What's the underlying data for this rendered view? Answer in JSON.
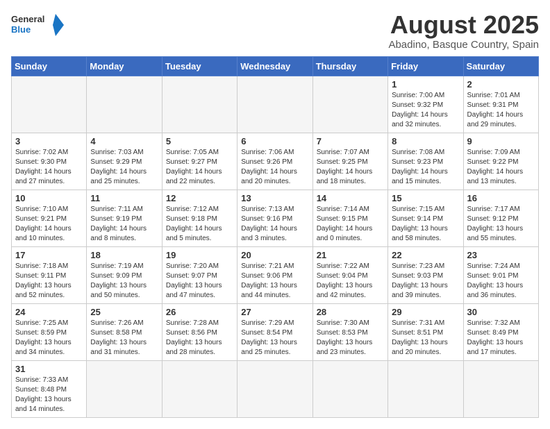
{
  "header": {
    "logo_general": "General",
    "logo_blue": "Blue",
    "title": "August 2025",
    "subtitle": "Abadino, Basque Country, Spain"
  },
  "weekdays": [
    "Sunday",
    "Monday",
    "Tuesday",
    "Wednesday",
    "Thursday",
    "Friday",
    "Saturday"
  ],
  "weeks": [
    [
      {
        "day": "",
        "info": ""
      },
      {
        "day": "",
        "info": ""
      },
      {
        "day": "",
        "info": ""
      },
      {
        "day": "",
        "info": ""
      },
      {
        "day": "",
        "info": ""
      },
      {
        "day": "1",
        "info": "Sunrise: 7:00 AM\nSunset: 9:32 PM\nDaylight: 14 hours and 32 minutes."
      },
      {
        "day": "2",
        "info": "Sunrise: 7:01 AM\nSunset: 9:31 PM\nDaylight: 14 hours and 29 minutes."
      }
    ],
    [
      {
        "day": "3",
        "info": "Sunrise: 7:02 AM\nSunset: 9:30 PM\nDaylight: 14 hours and 27 minutes."
      },
      {
        "day": "4",
        "info": "Sunrise: 7:03 AM\nSunset: 9:29 PM\nDaylight: 14 hours and 25 minutes."
      },
      {
        "day": "5",
        "info": "Sunrise: 7:05 AM\nSunset: 9:27 PM\nDaylight: 14 hours and 22 minutes."
      },
      {
        "day": "6",
        "info": "Sunrise: 7:06 AM\nSunset: 9:26 PM\nDaylight: 14 hours and 20 minutes."
      },
      {
        "day": "7",
        "info": "Sunrise: 7:07 AM\nSunset: 9:25 PM\nDaylight: 14 hours and 18 minutes."
      },
      {
        "day": "8",
        "info": "Sunrise: 7:08 AM\nSunset: 9:23 PM\nDaylight: 14 hours and 15 minutes."
      },
      {
        "day": "9",
        "info": "Sunrise: 7:09 AM\nSunset: 9:22 PM\nDaylight: 14 hours and 13 minutes."
      }
    ],
    [
      {
        "day": "10",
        "info": "Sunrise: 7:10 AM\nSunset: 9:21 PM\nDaylight: 14 hours and 10 minutes."
      },
      {
        "day": "11",
        "info": "Sunrise: 7:11 AM\nSunset: 9:19 PM\nDaylight: 14 hours and 8 minutes."
      },
      {
        "day": "12",
        "info": "Sunrise: 7:12 AM\nSunset: 9:18 PM\nDaylight: 14 hours and 5 minutes."
      },
      {
        "day": "13",
        "info": "Sunrise: 7:13 AM\nSunset: 9:16 PM\nDaylight: 14 hours and 3 minutes."
      },
      {
        "day": "14",
        "info": "Sunrise: 7:14 AM\nSunset: 9:15 PM\nDaylight: 14 hours and 0 minutes."
      },
      {
        "day": "15",
        "info": "Sunrise: 7:15 AM\nSunset: 9:14 PM\nDaylight: 13 hours and 58 minutes."
      },
      {
        "day": "16",
        "info": "Sunrise: 7:17 AM\nSunset: 9:12 PM\nDaylight: 13 hours and 55 minutes."
      }
    ],
    [
      {
        "day": "17",
        "info": "Sunrise: 7:18 AM\nSunset: 9:11 PM\nDaylight: 13 hours and 52 minutes."
      },
      {
        "day": "18",
        "info": "Sunrise: 7:19 AM\nSunset: 9:09 PM\nDaylight: 13 hours and 50 minutes."
      },
      {
        "day": "19",
        "info": "Sunrise: 7:20 AM\nSunset: 9:07 PM\nDaylight: 13 hours and 47 minutes."
      },
      {
        "day": "20",
        "info": "Sunrise: 7:21 AM\nSunset: 9:06 PM\nDaylight: 13 hours and 44 minutes."
      },
      {
        "day": "21",
        "info": "Sunrise: 7:22 AM\nSunset: 9:04 PM\nDaylight: 13 hours and 42 minutes."
      },
      {
        "day": "22",
        "info": "Sunrise: 7:23 AM\nSunset: 9:03 PM\nDaylight: 13 hours and 39 minutes."
      },
      {
        "day": "23",
        "info": "Sunrise: 7:24 AM\nSunset: 9:01 PM\nDaylight: 13 hours and 36 minutes."
      }
    ],
    [
      {
        "day": "24",
        "info": "Sunrise: 7:25 AM\nSunset: 8:59 PM\nDaylight: 13 hours and 34 minutes."
      },
      {
        "day": "25",
        "info": "Sunrise: 7:26 AM\nSunset: 8:58 PM\nDaylight: 13 hours and 31 minutes."
      },
      {
        "day": "26",
        "info": "Sunrise: 7:28 AM\nSunset: 8:56 PM\nDaylight: 13 hours and 28 minutes."
      },
      {
        "day": "27",
        "info": "Sunrise: 7:29 AM\nSunset: 8:54 PM\nDaylight: 13 hours and 25 minutes."
      },
      {
        "day": "28",
        "info": "Sunrise: 7:30 AM\nSunset: 8:53 PM\nDaylight: 13 hours and 23 minutes."
      },
      {
        "day": "29",
        "info": "Sunrise: 7:31 AM\nSunset: 8:51 PM\nDaylight: 13 hours and 20 minutes."
      },
      {
        "day": "30",
        "info": "Sunrise: 7:32 AM\nSunset: 8:49 PM\nDaylight: 13 hours and 17 minutes."
      }
    ],
    [
      {
        "day": "31",
        "info": "Sunrise: 7:33 AM\nSunset: 8:48 PM\nDaylight: 13 hours and 14 minutes."
      },
      {
        "day": "",
        "info": ""
      },
      {
        "day": "",
        "info": ""
      },
      {
        "day": "",
        "info": ""
      },
      {
        "day": "",
        "info": ""
      },
      {
        "day": "",
        "info": ""
      },
      {
        "day": "",
        "info": ""
      }
    ]
  ]
}
